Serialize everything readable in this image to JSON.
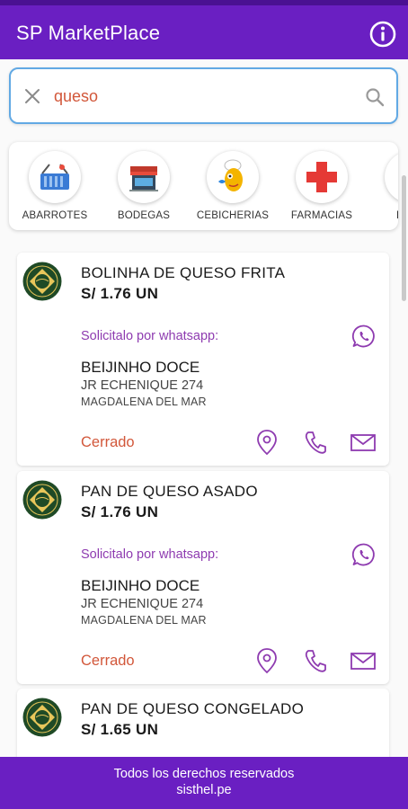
{
  "app": {
    "title": "SP MarketPlace"
  },
  "search": {
    "value": "queso",
    "placeholder": ""
  },
  "categories": [
    {
      "label": "ABARROTES",
      "icon": "groceries-basket-icon"
    },
    {
      "label": "BODEGAS",
      "icon": "storefront-icon"
    },
    {
      "label": "CEBICHERIAS",
      "icon": "chef-fish-icon"
    },
    {
      "label": "FARMACIAS",
      "icon": "red-cross-icon"
    },
    {
      "label": "FERR",
      "icon": "hardware-icon"
    }
  ],
  "products": [
    {
      "name": "BOLINHA DE QUESO FRITA",
      "price": "S/ 1.76 UN",
      "whatsapp_label": "Solicitalo por whatsapp:",
      "store": "BEIJINHO DOCE",
      "address_line1": "JR ECHENIQUE 274",
      "address_line2": "MAGDALENA DEL MAR",
      "status": "Cerrado"
    },
    {
      "name": "PAN DE QUESO ASADO",
      "price": "S/ 1.76 UN",
      "whatsapp_label": "Solicitalo por whatsapp:",
      "store": "BEIJINHO DOCE",
      "address_line1": "JR ECHENIQUE 274",
      "address_line2": "MAGDALENA DEL MAR",
      "status": "Cerrado"
    },
    {
      "name": "PAN DE QUESO CONGELADO",
      "price": "S/ 1.65 UN"
    }
  ],
  "footer": {
    "line1": "Todos los derechos reservados",
    "line2": "sisthel.pe"
  },
  "colors": {
    "primary": "#6a1fc2",
    "accent_purple": "#8e3bb0",
    "closed": "#d2573a",
    "search_border": "#62a9e4"
  }
}
